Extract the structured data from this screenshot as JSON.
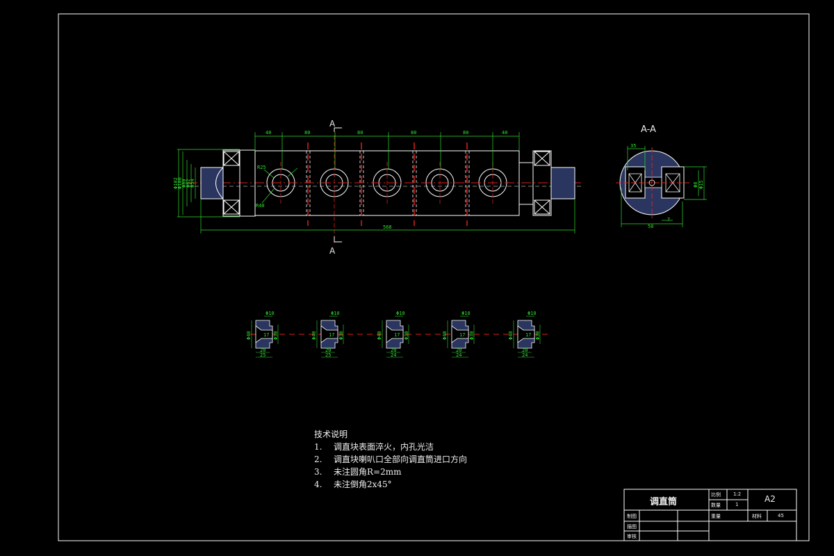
{
  "main_view": {
    "section_mark": "A",
    "top_dims": [
      "40",
      "80",
      "80",
      "80",
      "80",
      "40"
    ],
    "overall_length": "568",
    "left_dims": [
      "Φ102",
      "Φ100",
      "Φ80",
      "Φ62",
      "Φ54"
    ],
    "left_callouts": [
      "R25",
      "R40"
    ]
  },
  "section_view": {
    "title": "A-A",
    "dim_top": "35",
    "dim_bottom": "50",
    "dim_bottom_right": "7",
    "dim_right": [
      "Φ8",
      "Φ15"
    ]
  },
  "detail_views": [
    {
      "top": "Φ10",
      "left": "Φ40",
      "right": "Φ30",
      "mid": "17",
      "bottom": [
        "20",
        "25"
      ]
    },
    {
      "top": "Φ10",
      "left": "Φ40",
      "right": "Φ30",
      "mid": "17",
      "bottom": [
        "20",
        "25"
      ]
    },
    {
      "top": "Φ10",
      "left": "Φ40",
      "right": "Φ30",
      "mid": "17",
      "bottom": [
        "20",
        "24"
      ]
    },
    {
      "top": "Φ10",
      "left": "Φ40",
      "right": "Φ30",
      "mid": "17",
      "bottom": [
        "20",
        "24"
      ]
    },
    {
      "top": "Φ10",
      "left": "Φ40",
      "right": "Φ30",
      "mid": "17",
      "bottom": [
        "20",
        "24"
      ]
    }
  ],
  "tech_notes": {
    "heading": "技术说明",
    "items": [
      {
        "num": "1.",
        "text": "调直块表面淬火，内孔光洁"
      },
      {
        "num": "2.",
        "text": "调直块喇叭口全部向调直筒进口方向"
      },
      {
        "num": "3.",
        "text": "未注圆角R=2mm"
      },
      {
        "num": "4.",
        "text": "未注倒角2x45°"
      }
    ]
  },
  "title_block": {
    "part_name": "调直筒",
    "scale_label": "比例",
    "scale_value": "1:2",
    "qty_label": "数量",
    "qty_value": "1",
    "sheet_size": "A2",
    "weight_label": "重量",
    "material_label": "材料",
    "material_value": "45",
    "drawn_label": "制图",
    "designed_label": "描图",
    "checked_label": "审核"
  },
  "colors": {
    "background": "#000000",
    "outline": "#ffffff",
    "dimension": "#2fe02f",
    "centerline": "#e02020",
    "hatch": "#2a3560"
  }
}
